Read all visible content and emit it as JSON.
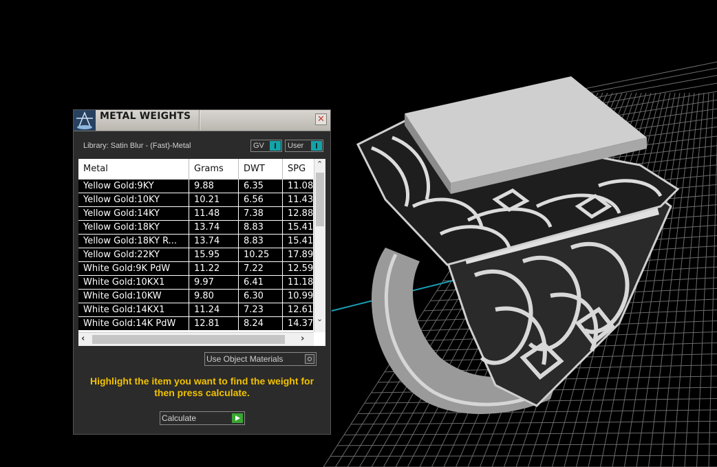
{
  "panel": {
    "title": "METAL WEIGHTS",
    "close_glyph": "✕",
    "library_label": "Library: Satin Blur - (Fast)-Metal",
    "toggles": {
      "gv": "GV",
      "user": "User"
    },
    "use_object_materials": "Use Object Materials",
    "hint": "Highlight the item you want to find the weight for then press calculate.",
    "calculate": "Calculate"
  },
  "table": {
    "columns": [
      "Metal",
      "Grams",
      "DWT",
      "SPG"
    ],
    "rows": [
      [
        "Yellow Gold:9KY",
        "9.88",
        "6.35",
        "11.08"
      ],
      [
        "Yellow Gold:10KY",
        "10.21",
        "6.56",
        "11.43"
      ],
      [
        "Yellow Gold:14KY",
        "11.48",
        "7.38",
        "12.88"
      ],
      [
        "Yellow Gold:18KY",
        "13.74",
        "8.83",
        "15.41"
      ],
      [
        "Yellow Gold:18KY R...",
        "13.74",
        "8.83",
        "15.41"
      ],
      [
        "Yellow Gold:22KY",
        "15.95",
        "10.25",
        "17.89"
      ],
      [
        "White Gold:9K PdW",
        "11.22",
        "7.22",
        "12.59"
      ],
      [
        "White Gold:10KX1",
        "9.97",
        "6.41",
        "11.18"
      ],
      [
        "White Gold:10KW",
        "9.80",
        "6.30",
        "10.99"
      ],
      [
        "White Gold:14KX1",
        "11.24",
        "7.23",
        "12.61"
      ],
      [
        "White Gold:14K PdW",
        "12.81",
        "8.24",
        "14.37"
      ]
    ]
  },
  "icons": {
    "logo": "scale-icon",
    "close": "close-icon",
    "scroll_up": "chevron-up-icon",
    "scroll_down": "chevron-down-icon",
    "scroll_left": "chevron-left-icon",
    "scroll_right": "chevron-right-icon",
    "calculate": "play-icon"
  },
  "colors": {
    "hint_text": "#f2c200",
    "toggle_accent": "#13a3a8",
    "calculate_accent": "#3aa632"
  }
}
